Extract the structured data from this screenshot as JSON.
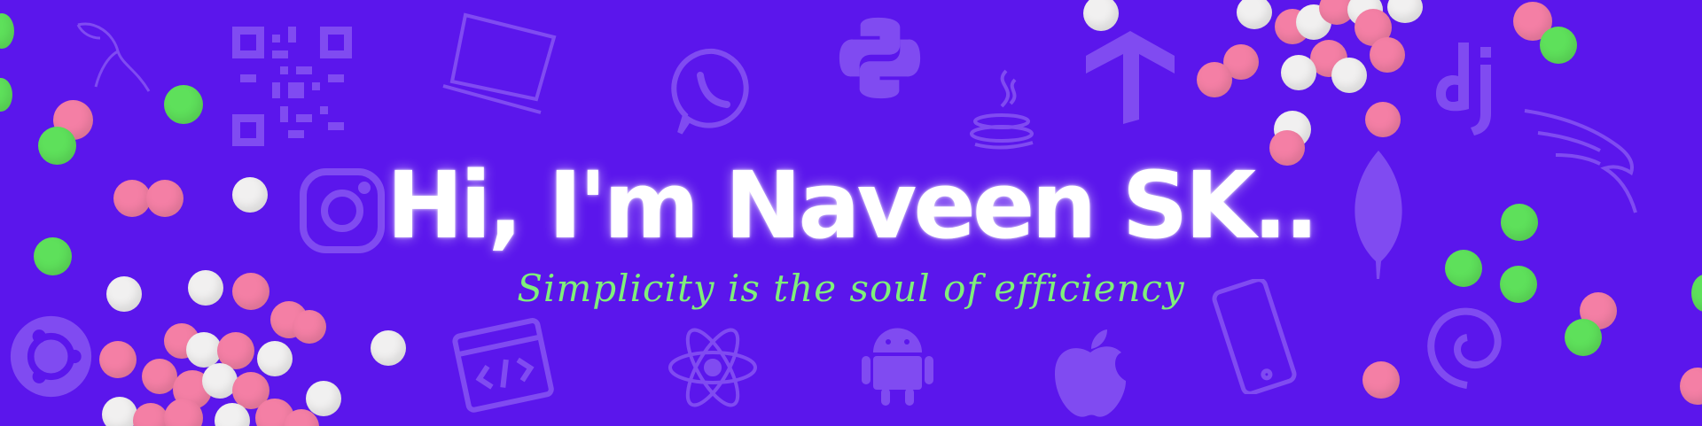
{
  "banner": {
    "headline": "Hi, I'm Naveen SK..",
    "tagline": "Simplicity is the soul of efficiency"
  },
  "colors": {
    "background": "#5b16ec",
    "headline": "#ffffff",
    "tagline": "#7ff07a",
    "confetti_green": "#5ee05b",
    "confetti_pink": "#f47fa5",
    "confetti_white": "#f1f0f0"
  },
  "icons": [
    "mysql-dolphin-icon",
    "qr-code-icon",
    "laptop-icon",
    "whatsapp-icon",
    "python-icon",
    "java-icon",
    "tensorflow-icon",
    "django-icon",
    "kali-linux-icon",
    "instagram-icon",
    "mongodb-leaf-icon",
    "ubuntu-icon",
    "code-window-icon",
    "react-icon",
    "android-icon",
    "apple-icon",
    "smartphone-icon",
    "debian-icon"
  ]
}
